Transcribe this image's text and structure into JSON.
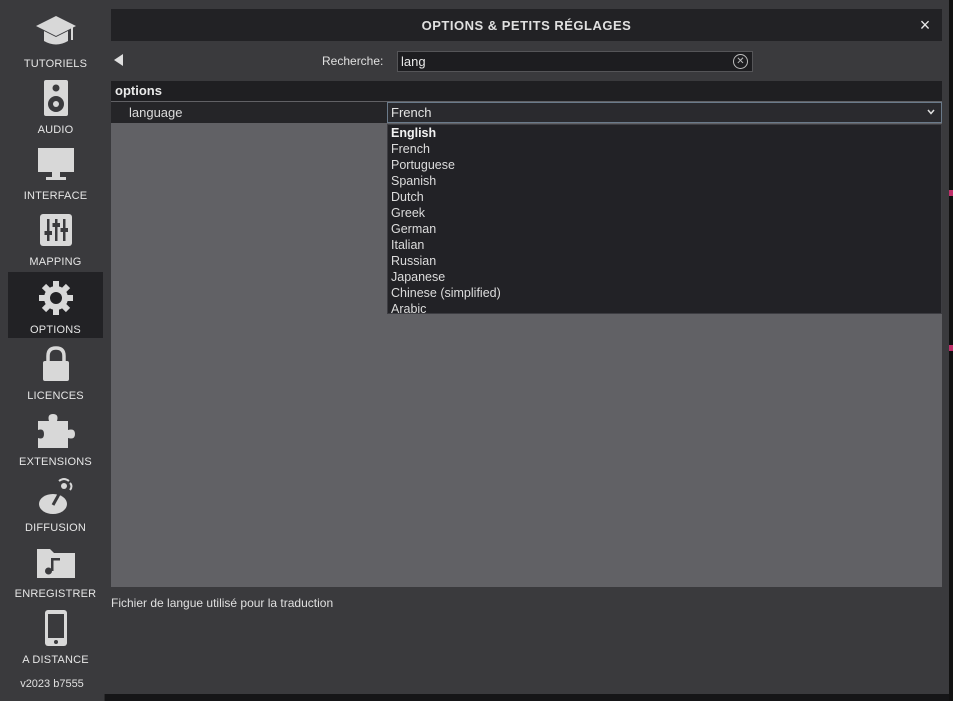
{
  "sidebar": {
    "items": [
      {
        "label": "TUTORIELS",
        "icon": "graduation-cap-icon"
      },
      {
        "label": "AUDIO",
        "icon": "speaker-icon"
      },
      {
        "label": "INTERFACE",
        "icon": "monitor-icon"
      },
      {
        "label": "MAPPING",
        "icon": "sliders-icon"
      },
      {
        "label": "OPTIONS",
        "icon": "gear-icon",
        "active": true
      },
      {
        "label": "LICENCES",
        "icon": "lock-icon"
      },
      {
        "label": "EXTENSIONS",
        "icon": "puzzle-icon"
      },
      {
        "label": "DIFFUSION",
        "icon": "broadcast-icon"
      },
      {
        "label": "ENREGISTRER",
        "icon": "music-folder-icon"
      },
      {
        "label": "A DISTANCE",
        "icon": "phone-icon"
      }
    ],
    "version": "v2023 b7555"
  },
  "dialog": {
    "title": "OPTIONS & PETITS RÉGLAGES",
    "close": "×"
  },
  "search": {
    "label": "Recherche:",
    "value": "lang"
  },
  "section": {
    "header": "options",
    "row": {
      "label": "language",
      "selected": "French"
    }
  },
  "dropdown": {
    "options": [
      "English",
      "French",
      "Portuguese",
      "Spanish",
      "Dutch",
      "Greek",
      "German",
      "Italian",
      "Russian",
      "Japanese",
      "Chinese (simplified)",
      "Arabic"
    ]
  },
  "description": "Fichier de langue utilisé pour la traduction",
  "colors": {
    "sidebar_bg": "#3a3a3d",
    "active_bg": "#222225",
    "panel_bg": "#616165",
    "accent_mark": "#c0306a"
  }
}
